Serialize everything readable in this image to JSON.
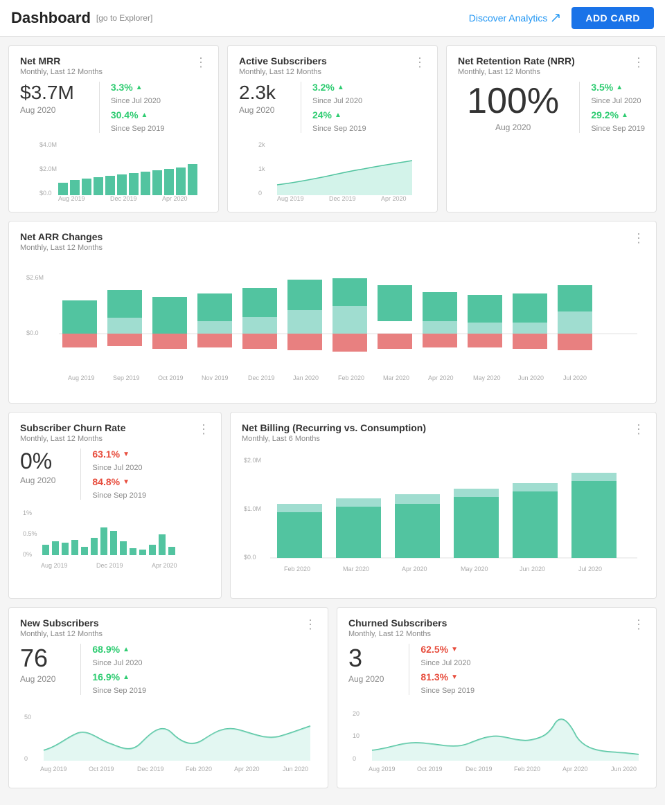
{
  "header": {
    "title": "Dashboard",
    "explorer_link": "[go to Explorer]",
    "discover_label": "Discover Analytics",
    "add_card_label": "ADD CARD"
  },
  "net_mrr": {
    "title": "Net MRR",
    "subtitle": "Monthly, Last 12 Months",
    "value": "$3.7M",
    "date": "Aug 2020",
    "stat1_pct": "3.3%",
    "stat1_label": "Since Jul 2020",
    "stat2_pct": "30.4%",
    "stat2_label": "Since Sep 2019"
  },
  "active_subscribers": {
    "title": "Active Subscribers",
    "subtitle": "Monthly, Last 12 Months",
    "value": "2.3k",
    "date": "Aug 2020",
    "stat1_pct": "3.2%",
    "stat1_label": "Since Jul 2020",
    "stat2_pct": "24%",
    "stat2_label": "Since Sep 2019"
  },
  "net_retention": {
    "title": "Net Retention Rate (NRR)",
    "subtitle": "Monthly, Last 12 Months",
    "value": "100%",
    "date": "Aug 2020",
    "stat1_pct": "3.5%",
    "stat1_label": "Since Jul 2020",
    "stat2_pct": "29.2%",
    "stat2_label": "Since Sep 2019"
  },
  "net_arr": {
    "title": "Net ARR Changes",
    "subtitle": "Monthly, Last 12 Months",
    "y_labels": [
      "$2.6M",
      "$0.0"
    ],
    "x_labels": [
      "Aug 2019",
      "Sep 2019",
      "Oct 2019",
      "Nov 2019",
      "Dec 2019",
      "Jan 2020",
      "Feb 2020",
      "Mar 2020",
      "Apr 2020",
      "May 2020",
      "Jun 2020",
      "Jul 2020"
    ]
  },
  "subscriber_churn": {
    "title": "Subscriber Churn Rate",
    "subtitle": "Monthly, Last 12 Months",
    "value": "0%",
    "date": "Aug 2020",
    "stat1_pct": "63.1%",
    "stat1_label": "Since Jul 2020",
    "stat2_pct": "84.8%",
    "stat2_label": "Since Sep 2019",
    "y_labels": [
      "1%",
      "0.5%",
      "0%"
    ],
    "x_labels": [
      "Aug 2019",
      "Dec 2019",
      "Apr 2020"
    ]
  },
  "net_billing": {
    "title": "Net Billing (Recurring vs. Consumption)",
    "subtitle": "Monthly, Last 6 Months",
    "y_labels": [
      "$2.0M",
      "$1.0M",
      "$0.0"
    ],
    "x_labels": [
      "Feb 2020",
      "Mar 2020",
      "Apr 2020",
      "May 2020",
      "Jun 2020",
      "Jul 2020"
    ]
  },
  "new_subscribers": {
    "title": "New Subscribers",
    "subtitle": "Monthly, Last 12 Months",
    "value": "76",
    "date": "Aug 2020",
    "stat1_pct": "68.9%",
    "stat1_label": "Since Jul 2020",
    "stat2_pct": "16.9%",
    "stat2_label": "Since Sep 2019",
    "y_labels": [
      "50",
      "0"
    ],
    "x_labels": [
      "Aug 2019",
      "Oct 2019",
      "Dec 2019",
      "Feb 2020",
      "Apr 2020",
      "Jun 2020"
    ]
  },
  "churned_subscribers": {
    "title": "Churned Subscribers",
    "subtitle": "Monthly, Last 12 Months",
    "value": "3",
    "date": "Aug 2020",
    "stat1_pct": "62.5%",
    "stat1_label": "Since Jul 2020",
    "stat2_pct": "81.3%",
    "stat2_label": "Since Sep 2019",
    "y_labels": [
      "20",
      "10",
      "0"
    ],
    "x_labels": [
      "Aug 2019",
      "Oct 2019",
      "Dec 2019",
      "Feb 2020",
      "Apr 2020",
      "Jun 2020"
    ]
  }
}
